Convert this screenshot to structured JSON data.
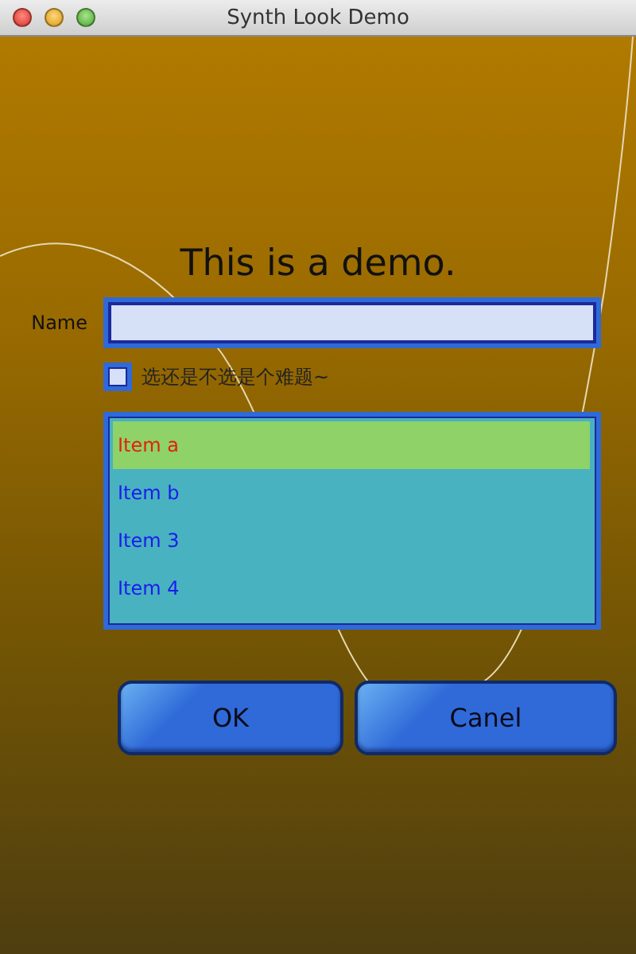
{
  "window": {
    "title": "Synth Look Demo"
  },
  "heading": "This is a demo.",
  "name_field": {
    "label": "Name"
  },
  "checkbox": {
    "label": "选还是不选是个难题~",
    "checked": false
  },
  "list": {
    "items": [
      {
        "label": "Item a",
        "selected": true
      },
      {
        "label": "Item b",
        "selected": false
      },
      {
        "label": "Item 3",
        "selected": false
      },
      {
        "label": "Item 4",
        "selected": false
      }
    ]
  },
  "buttons": [
    "OK",
    "Canel"
  ]
}
